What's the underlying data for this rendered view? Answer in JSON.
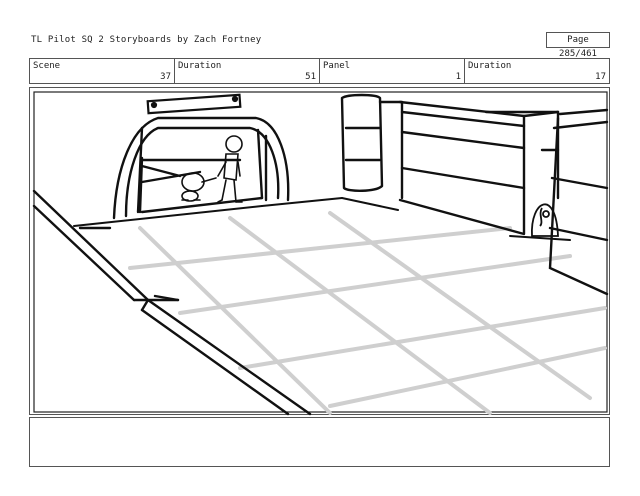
{
  "header": {
    "title": "TL Pilot SQ 2 Storyboards  by Zach Fortney",
    "page": "Page 285/461"
  },
  "info": {
    "scene_label": "Scene",
    "scene_value": "37",
    "duration1_label": "Duration",
    "duration1_value": "51",
    "panel_label": "Panel",
    "panel_value": "1",
    "duration2_label": "Duration",
    "duration2_value": "17"
  },
  "notes": {
    "text": ""
  }
}
